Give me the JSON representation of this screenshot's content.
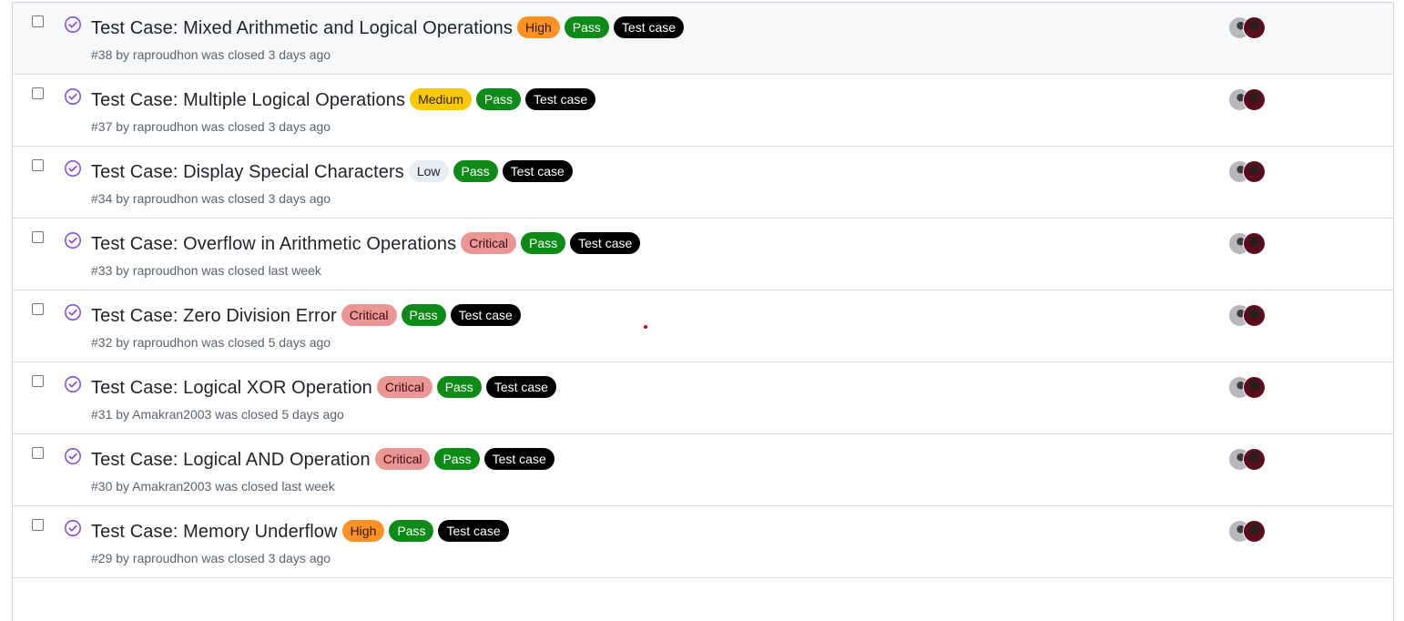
{
  "issues": [
    {
      "title": "Test Case: Mixed Arithmetic and Logical Operations",
      "labels": [
        {
          "text": "High",
          "kind": "high"
        },
        {
          "text": "Pass",
          "kind": "pass"
        },
        {
          "text": "Test case",
          "kind": "testcase"
        }
      ],
      "meta": "#38 by raproudhon was closed 3 days ago",
      "hover": true
    },
    {
      "title": "Test Case: Multiple Logical Operations",
      "labels": [
        {
          "text": "Medium",
          "kind": "medium"
        },
        {
          "text": "Pass",
          "kind": "pass"
        },
        {
          "text": "Test case",
          "kind": "testcase"
        }
      ],
      "meta": "#37 by raproudhon was closed 3 days ago",
      "hover": false
    },
    {
      "title": "Test Case: Display Special Characters",
      "labels": [
        {
          "text": "Low",
          "kind": "low"
        },
        {
          "text": "Pass",
          "kind": "pass"
        },
        {
          "text": "Test case",
          "kind": "testcase"
        }
      ],
      "meta": "#34 by raproudhon was closed 3 days ago",
      "hover": false
    },
    {
      "title": "Test Case: Overflow in Arithmetic Operations",
      "labels": [
        {
          "text": "Critical",
          "kind": "critical"
        },
        {
          "text": "Pass",
          "kind": "pass"
        },
        {
          "text": "Test case",
          "kind": "testcase"
        }
      ],
      "meta": "#33 by raproudhon was closed last week",
      "hover": false
    },
    {
      "title": "Test Case: Zero Division Error",
      "labels": [
        {
          "text": "Critical",
          "kind": "critical"
        },
        {
          "text": "Pass",
          "kind": "pass"
        },
        {
          "text": "Test case",
          "kind": "testcase"
        }
      ],
      "meta": "#32 by raproudhon was closed 5 days ago",
      "hover": false
    },
    {
      "title": "Test Case: Logical XOR Operation",
      "labels": [
        {
          "text": "Critical",
          "kind": "critical"
        },
        {
          "text": "Pass",
          "kind": "pass"
        },
        {
          "text": "Test case",
          "kind": "testcase"
        }
      ],
      "meta": "#31 by Amakran2003 was closed 5 days ago",
      "hover": false
    },
    {
      "title": "Test Case: Logical AND Operation",
      "labels": [
        {
          "text": "Critical",
          "kind": "critical"
        },
        {
          "text": "Pass",
          "kind": "pass"
        },
        {
          "text": "Test case",
          "kind": "testcase"
        }
      ],
      "meta": "#30 by Amakran2003 was closed last week",
      "hover": false
    },
    {
      "title": "Test Case: Memory Underflow",
      "labels": [
        {
          "text": "High",
          "kind": "high"
        },
        {
          "text": "Pass",
          "kind": "pass"
        },
        {
          "text": "Test case",
          "kind": "testcase"
        }
      ],
      "meta": "#29 by raproudhon was closed 3 days ago",
      "hover": false
    }
  ],
  "icons": {
    "state": "closed-completed-check-circle-icon"
  },
  "colors": {
    "closed_purple": "#8250df",
    "pass_green": "#0e8a16",
    "critical_pink": "#e99695",
    "high_orange": "#fb9223",
    "medium_yellow": "#fbca04",
    "low_gray": "#e6eef3"
  }
}
